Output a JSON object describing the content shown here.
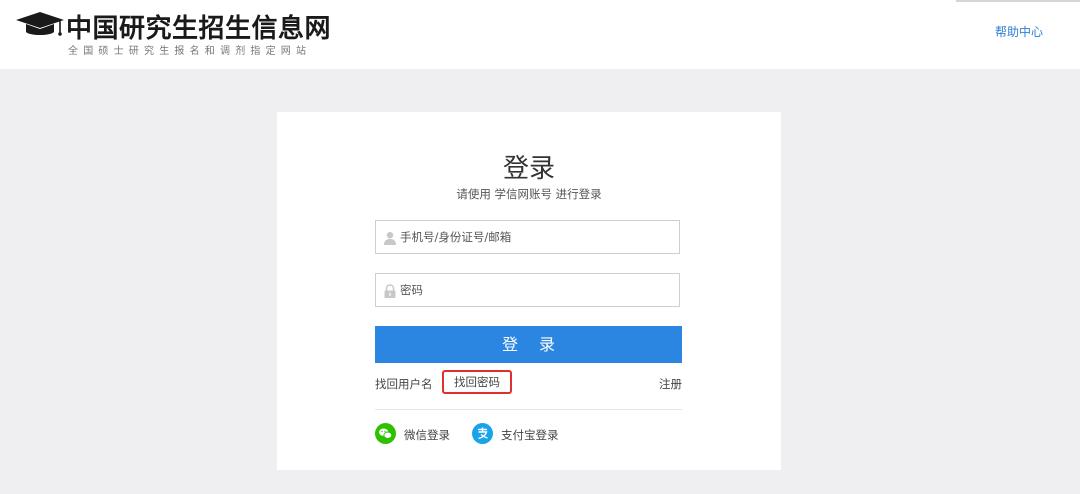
{
  "header": {
    "site_title": "中国研究生招生信息网",
    "site_subtitle": "全国硕士研究生报名和调剂指定网站",
    "help_link": "帮助中心"
  },
  "login": {
    "title": "登录",
    "subtitle": "请使用 学信网账号 进行登录",
    "username_placeholder": "手机号/身份证号/邮箱",
    "password_placeholder": "密码",
    "submit_label": "登 录",
    "find_username": "找回用户名",
    "find_password": "找回密码",
    "register": "注册",
    "wechat_login": "微信登录",
    "alipay_login": "支付宝登录"
  },
  "icons": {
    "logo": "graduation-cap-icon",
    "username": "user-icon",
    "password": "lock-icon",
    "wechat": "wechat-icon",
    "alipay": "alipay-icon"
  },
  "colors": {
    "primary_button": "#2a86e0",
    "help_link": "#2c7fd6",
    "highlight_border": "#e02f2f",
    "wechat_green": "#2dc100",
    "alipay_blue": "#1aa3e8",
    "page_background": "#efeff1"
  }
}
